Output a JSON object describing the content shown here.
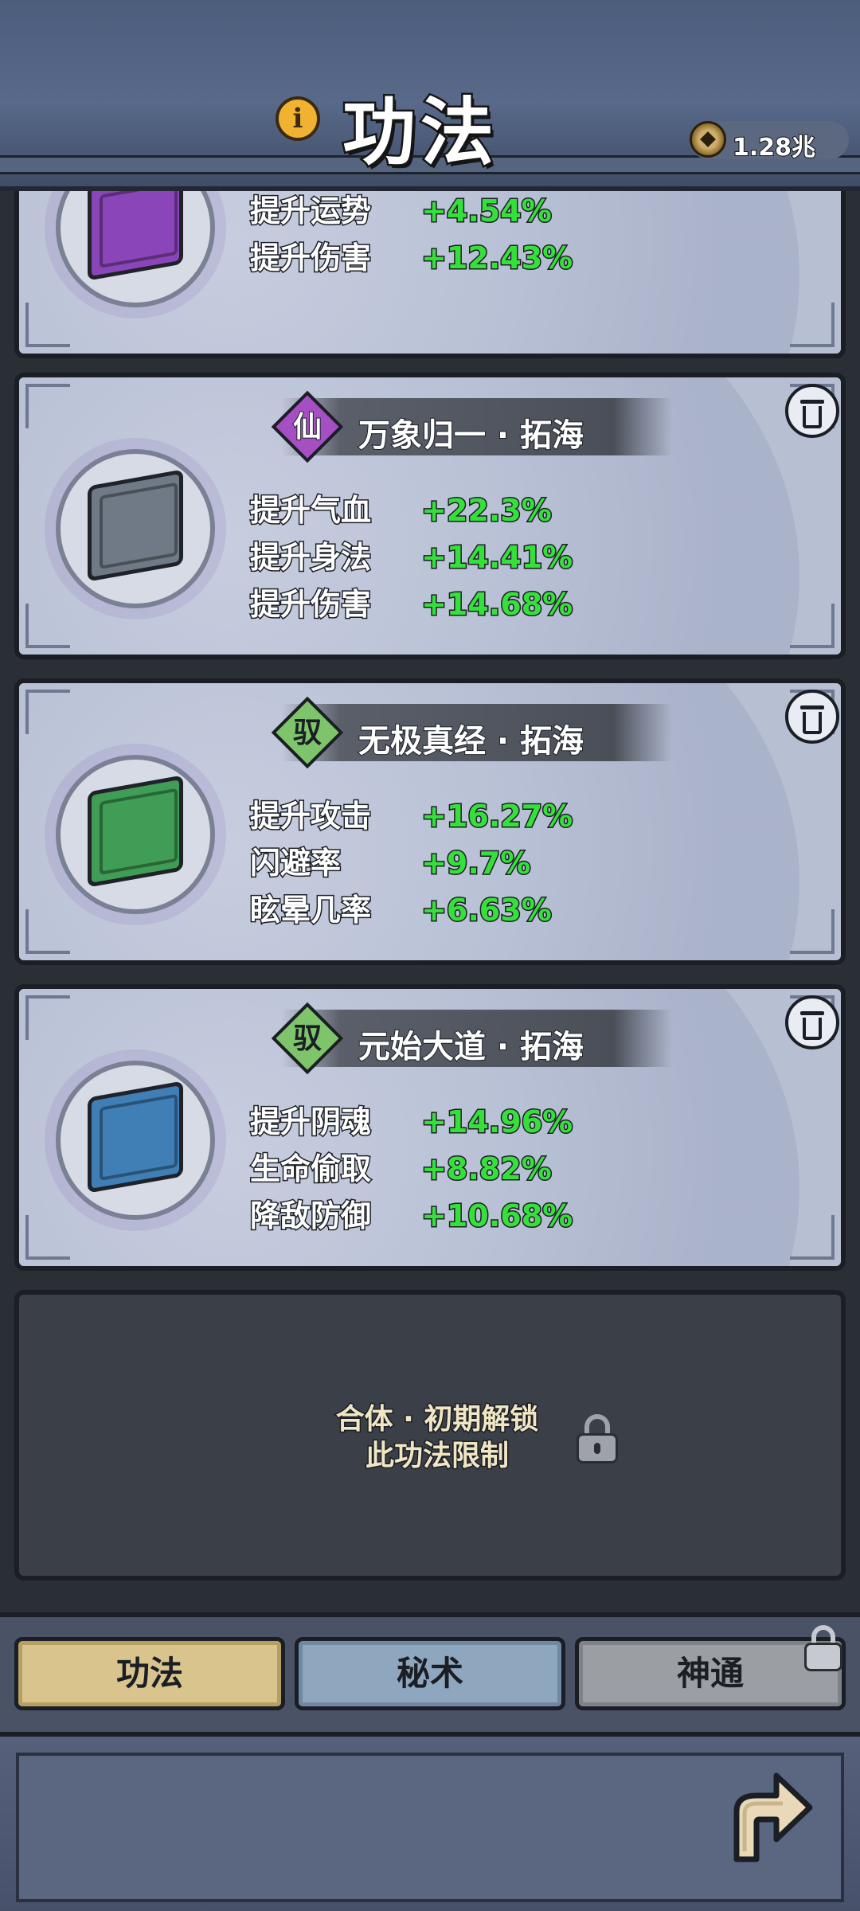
{
  "header": {
    "title": "功法",
    "currency_value": "1.28兆"
  },
  "cards": [
    {
      "grade": "",
      "name": "",
      "stats": [
        {
          "label": "提升运势",
          "value": "+4.54%"
        },
        {
          "label": "提升伤害",
          "value": "+12.43%"
        }
      ]
    },
    {
      "grade": "仙",
      "name": "万象归一 · 拓海",
      "stats": [
        {
          "label": "提升气血",
          "value": "+22.3%"
        },
        {
          "label": "提升身法",
          "value": "+14.41%"
        },
        {
          "label": "提升伤害",
          "value": "+14.68%"
        }
      ]
    },
    {
      "grade": "驭",
      "name": "无极真经 · 拓海",
      "stats": [
        {
          "label": "提升攻击",
          "value": "+16.27%"
        },
        {
          "label": "闪避率",
          "value": "+9.7%"
        },
        {
          "label": "眩晕几率",
          "value": "+6.63%"
        }
      ]
    },
    {
      "grade": "驭",
      "name": "元始大道 · 拓海",
      "stats": [
        {
          "label": "提升阴魂",
          "value": "+14.96%"
        },
        {
          "label": "生命偷取",
          "value": "+8.82%"
        },
        {
          "label": "降敌防御",
          "value": "+10.68%"
        }
      ]
    }
  ],
  "locked_slot": {
    "line1": "合体 · 初期解锁",
    "line2": "此功法限制"
  },
  "tabs": {
    "gongfa": "功法",
    "mishu": "秘术",
    "shentong": "神通"
  },
  "colors": {
    "purple_book": "#8a45b8",
    "gray_book": "#6f7a86",
    "green_book": "#3f9d55",
    "blue_book": "#3f7fb6",
    "xian_badge": "#a64fc2",
    "yu_badge": "#7ec46a",
    "stat_green": "#36e03a"
  }
}
